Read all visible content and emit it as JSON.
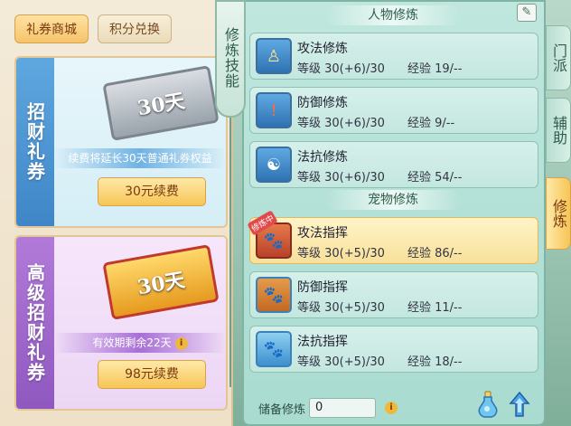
{
  "left_tabs": [
    "礼券商城",
    "积分兑换"
  ],
  "card1": {
    "label": "招财礼券",
    "ticket_text": "30天",
    "note": "续费将延长30天普通礼券权益",
    "button": "30元续费"
  },
  "card2": {
    "label": "高级招财礼券",
    "ticket_text": "30天",
    "note": "有效期剩余22天",
    "button": "98元续费"
  },
  "skills_strip": "修炼技能",
  "sections": {
    "person": "人物修炼",
    "pet": "宠物修炼"
  },
  "person_rows": [
    {
      "name": "攻法修炼",
      "level": "等级 30(+6)/30",
      "exp": "经验 19/--",
      "icon": "warrior-icon"
    },
    {
      "name": "防御修炼",
      "level": "等级 30(+6)/30",
      "exp": "经验 9/--",
      "icon": "shield-icon"
    },
    {
      "name": "法抗修炼",
      "level": "等级 30(+6)/30",
      "exp": "经验 54/--",
      "icon": "yin-yang-icon"
    }
  ],
  "pet_rows": [
    {
      "name": "攻法指挥",
      "level": "等级 30(+5)/30",
      "exp": "经验 86/--",
      "icon": "paw-attack-icon",
      "badge": "修炼中"
    },
    {
      "name": "防御指挥",
      "level": "等级 30(+5)/30",
      "exp": "经验 11/--",
      "icon": "paw-defense-icon"
    },
    {
      "name": "法抗指挥",
      "level": "等级 30(+5)/30",
      "exp": "经验 18/--",
      "icon": "paw-resist-icon"
    }
  ],
  "reserve": {
    "label": "储备修炼",
    "value": "0"
  },
  "side_tabs": [
    "门派",
    "辅助",
    "修炼"
  ],
  "colors": {
    "accent": "#f6c555",
    "panel": "#bfe7de",
    "blue_card": "#3f86c8",
    "purple_card": "#8f58c0"
  }
}
